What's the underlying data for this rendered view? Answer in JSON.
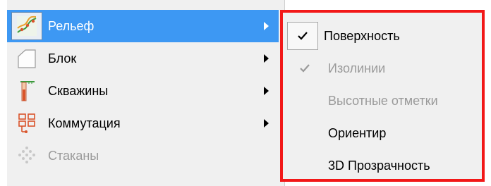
{
  "menu": {
    "items": [
      {
        "label": "Рельеф",
        "icon": "relief-icon",
        "selected": true,
        "has_submenu": true,
        "disabled": false
      },
      {
        "label": "Блок",
        "icon": "block-icon",
        "selected": false,
        "has_submenu": true,
        "disabled": false
      },
      {
        "label": "Скважины",
        "icon": "well-icon",
        "selected": false,
        "has_submenu": true,
        "disabled": false
      },
      {
        "label": "Коммутация",
        "icon": "switching-icon",
        "selected": false,
        "has_submenu": true,
        "disabled": false
      },
      {
        "label": "Стаканы",
        "icon": "glasses-icon",
        "selected": false,
        "has_submenu": false,
        "disabled": true
      }
    ]
  },
  "submenu": {
    "items": [
      {
        "label": "Поверхность",
        "checked": true,
        "disabled": false
      },
      {
        "label": "Изолинии",
        "checked": true,
        "disabled": true
      },
      {
        "label": "Высотные отметки",
        "checked": false,
        "disabled": true
      },
      {
        "label": "Ориентир",
        "checked": false,
        "disabled": false
      },
      {
        "label": "3D Прозрачность",
        "checked": false,
        "disabled": false
      }
    ]
  },
  "colors": {
    "selection": "#3d98f3",
    "highlight_border": "#f21818",
    "menu_background": "#f0f0f0",
    "disabled_text": "#9a9a9a"
  }
}
